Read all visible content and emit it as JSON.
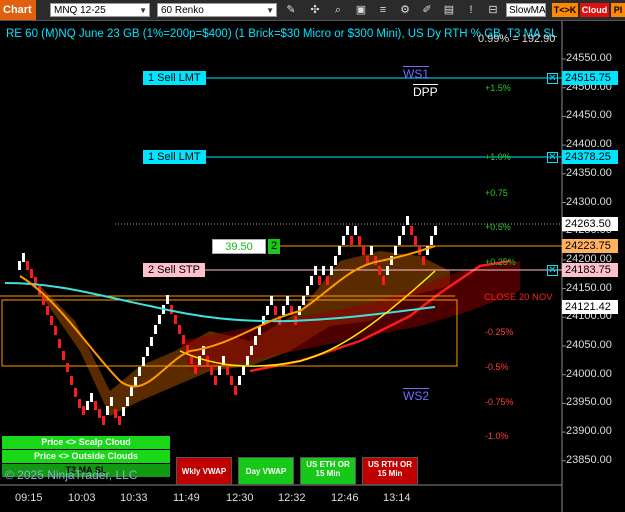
{
  "toolbar": {
    "tab_label": "Chart",
    "instrument": "MNQ 12-25",
    "bar_type": "60 Renko",
    "indicator_select": "SlowMA",
    "tc_button": "T<>K",
    "cloud_button": "Cloud",
    "pl_button": "Pl"
  },
  "title": "RE 60 (M)NQ June 23 GB (1%=200p=$400) (1 Brick=$30 Micro or $300 Mini), US Dy RTH % GB, T3 MA SL",
  "title_overlay": "0.99% = 192.90",
  "price_axis": [
    "24550.00",
    "24500.00",
    "24450.00",
    "24400.00",
    "24350.00",
    "24300.00",
    "24250.00",
    "24200.00",
    "24150.00",
    "24100.00",
    "24050.00",
    "24000.00",
    "23950.00",
    "23900.00",
    "23850.00"
  ],
  "time_axis": [
    "09:15",
    "10:03",
    "10:33",
    "11:49",
    "12:30",
    "12:32",
    "12:46",
    "13:14"
  ],
  "percent_levels": [
    {
      "label": "+1.5%",
      "color": "#22cc22"
    },
    {
      "label": "+1.0%",
      "color": "#22cc22"
    },
    {
      "label": "+0.75",
      "color": "#22cc22"
    },
    {
      "label": "+0.5%",
      "color": "#22cc22"
    },
    {
      "label": "+0.25%",
      "color": "#22cc22"
    },
    {
      "label": "-0.25%",
      "color": "#ff4040"
    },
    {
      "label": "-0.5%",
      "color": "#ff4040"
    },
    {
      "label": "-0.75%",
      "color": "#ff4040"
    },
    {
      "label": "-1.0%",
      "color": "#ff4040"
    }
  ],
  "ws1": "WS1",
  "ws2": "WS2",
  "dpp": "DPP",
  "close_label": "CLOSE 20 NOV",
  "orders": [
    {
      "label": "1 Sell LMT",
      "price": "24515.75"
    },
    {
      "label": "1 Sell LMT",
      "price": "24378.25"
    },
    {
      "label": "2 Sell STP",
      "price": "24183.75"
    }
  ],
  "price_tags": {
    "last": "24263.50",
    "avg": "24223.75",
    "level": "24121.42"
  },
  "position": {
    "price": "39.50",
    "qty": "2"
  },
  "side_buttons": [
    "Price <> Scalp Cloud",
    "Price <> Outside Clouds",
    "T3 MA SL"
  ],
  "copyright": "© 2025 NinjaTrader, LLC",
  "bottom_buttons": [
    {
      "label": "Wkly VWAP",
      "color": "#c00000"
    },
    {
      "label": "Day VWAP",
      "color": "#18c818"
    },
    {
      "label": "US ETH OR 15 Min",
      "color": "#18c818"
    },
    {
      "label": "US RTH OR 15 Min",
      "color": "#c00000"
    }
  ],
  "colors": {
    "accent": "#00e5ff",
    "up": "#ffffff",
    "down": "#ff1a1a",
    "orange": "#ff9900",
    "cloud": "#7a3a00",
    "green_btn": "#18d818"
  }
}
